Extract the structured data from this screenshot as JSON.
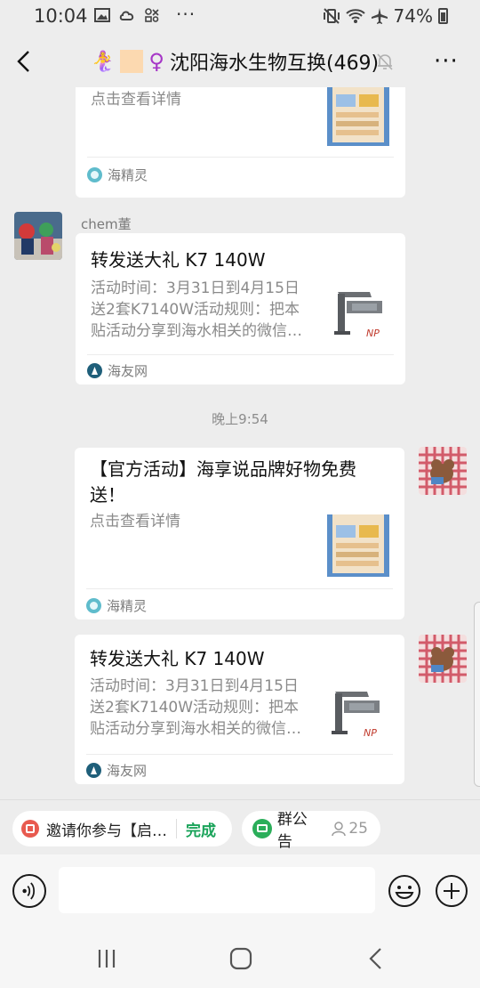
{
  "status_bar": {
    "time": "10:04",
    "battery": "74%",
    "overflow": "···"
  },
  "header": {
    "emoji": "🧜‍♀️",
    "female_sign": "♀",
    "title": "沈阳海水生物互换(469)",
    "more": "···"
  },
  "messages": [
    {
      "type": "link_card",
      "side": "left",
      "partial": true,
      "desc": "点击查看详情",
      "source": "海精灵"
    },
    {
      "type": "link_card",
      "side": "left",
      "sender": "chem董",
      "title": "转发送大礼 K7 140W",
      "desc": [
        "活动时间：3月31日到4月15日",
        "送2套K7140W活动规则：把本",
        "贴活动分享到海水相关的微信…"
      ],
      "thumb_text": "NP",
      "source": "海友网"
    },
    {
      "type": "time",
      "text": "晚上9:54"
    },
    {
      "type": "link_card",
      "side": "right",
      "title": [
        "【官方活动】海享说品牌好物免费",
        "送！"
      ],
      "desc": "点击查看详情",
      "source": "海精灵"
    },
    {
      "type": "link_card",
      "side": "right",
      "title": "转发送大礼 K7 140W",
      "desc": [
        "活动时间：3月31日到4月15日",
        "送2套K7140W活动规则：把本",
        "贴活动分享到海水相关的微信…"
      ],
      "thumb_text": "NP",
      "source": "海友网"
    }
  ],
  "quick_bar": {
    "invite_label": "邀请你参与【启…",
    "invite_action": "完成",
    "notice_label": "群公告",
    "notice_count": "25"
  },
  "input_bar": {
    "placeholder": ""
  },
  "colors": {
    "background": "#ededed",
    "card": "#ffffff",
    "done_green": "#1aa35a",
    "accent_purple": "#a637c7"
  }
}
